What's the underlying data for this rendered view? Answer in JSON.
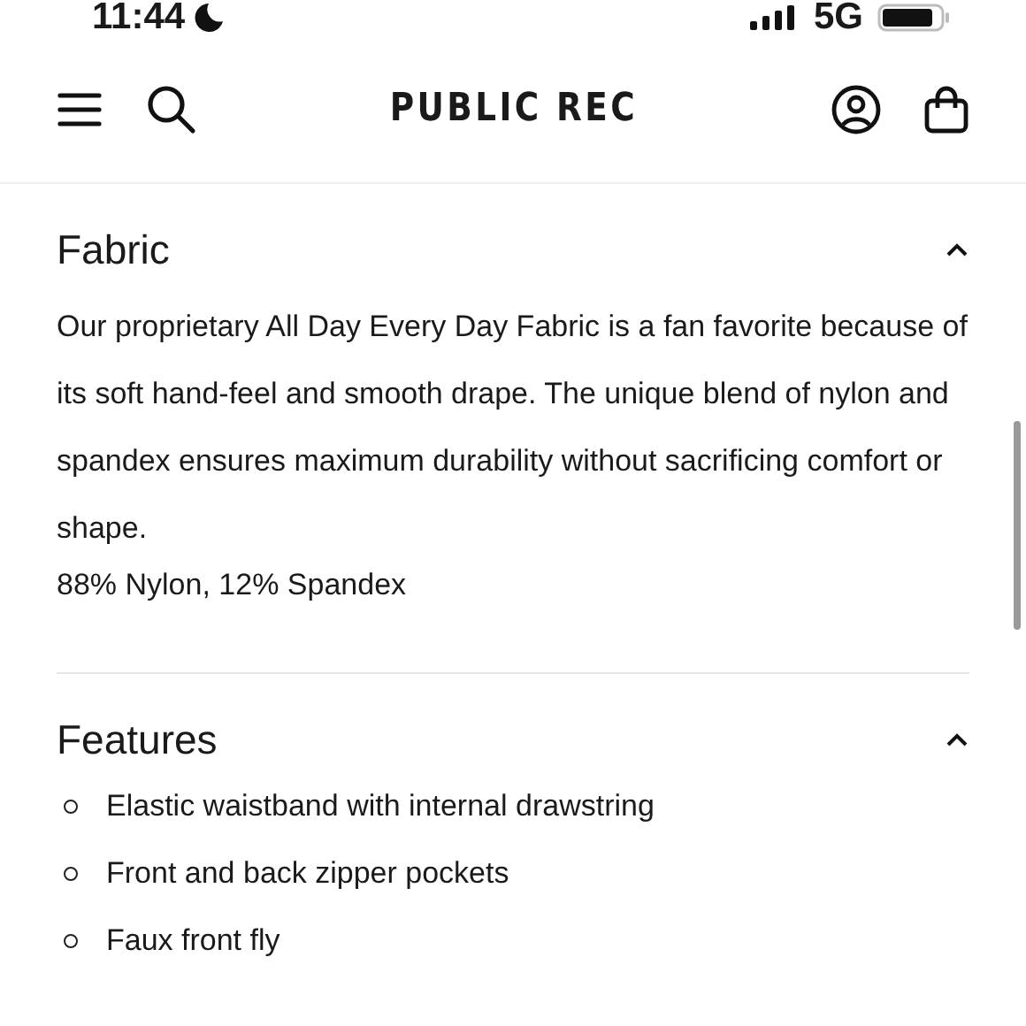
{
  "status_bar": {
    "time": "11:44",
    "network": "5G"
  },
  "header": {
    "logo": "PUBLIC REC"
  },
  "sections": [
    {
      "title": "Fabric",
      "expanded": true,
      "body": [
        {
          "kind": "text",
          "text": "Our proprietary All Day Every Day Fabric is a fan favorite because of its soft hand-feel and smooth drape. The unique blend of nylon and spandex ensures maximum durability without sacrificing comfort or shape."
        },
        {
          "kind": "spec",
          "text": "88% Nylon, 12% Spandex"
        }
      ]
    },
    {
      "title": "Features",
      "expanded": true,
      "body": [
        {
          "kind": "bullet",
          "text": "Elastic waistband with internal drawstring"
        },
        {
          "kind": "bullet",
          "text": "Front and back zipper pockets"
        },
        {
          "kind": "bullet",
          "text": "Faux front fly"
        }
      ]
    }
  ]
}
